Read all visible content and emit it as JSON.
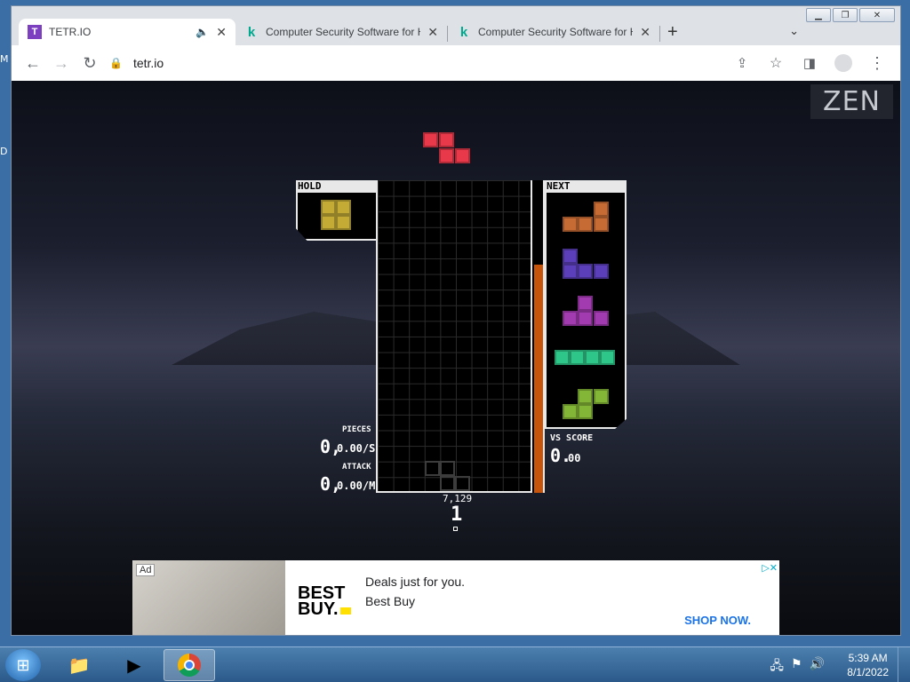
{
  "desktop": {
    "icon_label_1": "M",
    "icon_label_2": "D"
  },
  "browser": {
    "tabs": [
      {
        "title": "TETR.IO",
        "favicon": "tetrio-icon",
        "audio": "speaker-icon"
      },
      {
        "title": "Computer Security Software for H",
        "favicon": "kaspersky-icon"
      },
      {
        "title": "Computer Security Software for H",
        "favicon": "kaspersky-icon"
      }
    ],
    "address": "tetr.io"
  },
  "game": {
    "mode": "ZEN",
    "hold_label": "HOLD",
    "next_label": "NEXT",
    "hold_piece": "O",
    "active_piece": "Z",
    "next_queue": [
      "L",
      "J",
      "T",
      "I",
      "S"
    ],
    "pieces_label": "PIECES",
    "pieces_count": "0,",
    "pieces_rate": "0.00/S",
    "attack_label": "ATTACK",
    "attack_count": "0,",
    "attack_rate": "0.00/M",
    "vs_label": "VS SCORE",
    "vs_score_int": "0.",
    "vs_score_dec": "00",
    "score": "7,129",
    "level": "1",
    "garbage_meter_fraction": 0.73,
    "colors": {
      "Z": "#e8394a",
      "O": "#c3ab36",
      "L": "#c76b35",
      "J": "#5b3fba",
      "T": "#a33bb0",
      "I": "#2fc689",
      "S": "#83b636",
      "meter": "#c6550b"
    }
  },
  "ad": {
    "badge": "Ad",
    "brand": "BEST BUY",
    "headline": "Deals just for you.",
    "advertiser": "Best Buy",
    "cta": "SHOP NOW."
  },
  "taskbar": {
    "time": "5:39 AM",
    "date": "8/1/2022"
  }
}
